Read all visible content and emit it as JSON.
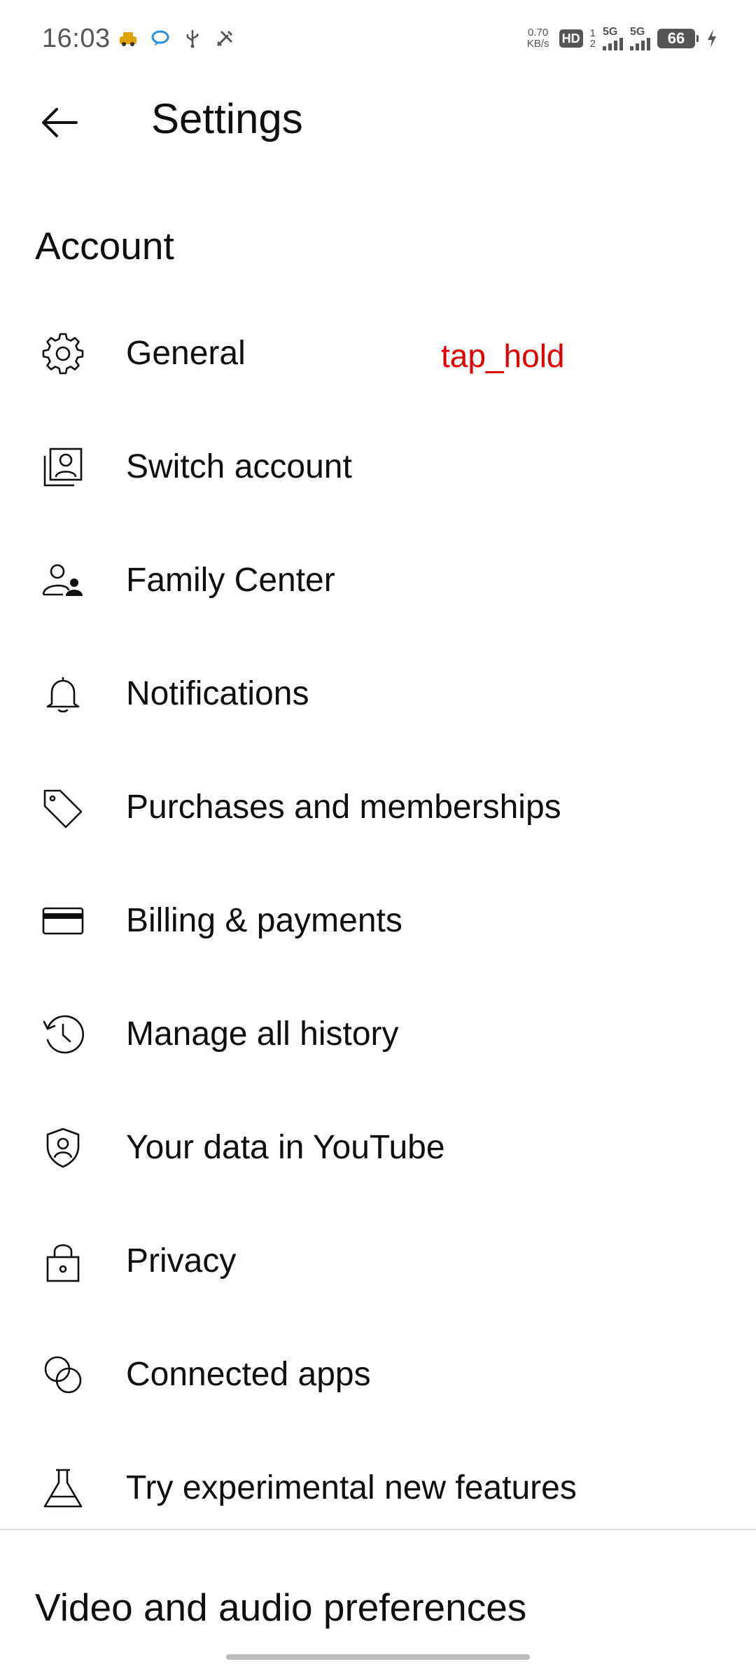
{
  "status_bar": {
    "time": "16:03",
    "net_speed_value": "0.70",
    "net_speed_unit": "KB/s",
    "hd_badge": "HD",
    "hd_sub_top": "1",
    "hd_sub_bottom": "2",
    "sim1_label": "5G",
    "sim2_label": "5G",
    "battery_level": "66"
  },
  "header": {
    "title": "Settings"
  },
  "sections": {
    "account": "Account",
    "video": "Video and audio preferences"
  },
  "items": [
    {
      "label": "General",
      "icon": "gear-icon"
    },
    {
      "label": "Switch account",
      "icon": "switch-account-icon"
    },
    {
      "label": "Family Center",
      "icon": "family-icon"
    },
    {
      "label": "Notifications",
      "icon": "bell-icon"
    },
    {
      "label": "Purchases and memberships",
      "icon": "tag-icon"
    },
    {
      "label": "Billing & payments",
      "icon": "credit-card-icon"
    },
    {
      "label": "Manage all history",
      "icon": "history-icon"
    },
    {
      "label": "Your data in YouTube",
      "icon": "shield-person-icon"
    },
    {
      "label": "Privacy",
      "icon": "lock-icon"
    },
    {
      "label": "Connected apps",
      "icon": "connected-circles-icon"
    },
    {
      "label": "Try experimental new features",
      "icon": "flask-icon"
    }
  ],
  "annotation": {
    "text": "tap_hold",
    "color": "#e00000"
  }
}
